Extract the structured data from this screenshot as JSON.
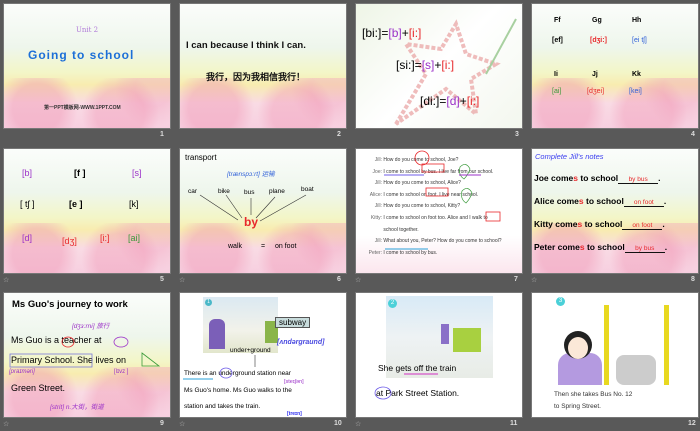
{
  "slides": [
    {
      "number": "1",
      "unit": "Unit 2",
      "title": "Going to school",
      "footer": "第一PPT模板网-WWW.1PPT.COM"
    },
    {
      "number": "2",
      "english": "I can because  I think I can.",
      "chinese": "我行，因为我相信我行！"
    },
    {
      "number": "3",
      "line1": [
        "[bi:]=",
        "[b]",
        "+",
        "[i:]"
      ],
      "line2": [
        "[si:]=",
        "[s]",
        "+",
        "[i:]"
      ],
      "line3": [
        "[di:]=",
        "[d]",
        "+",
        "[i:]"
      ]
    },
    {
      "number": "4",
      "letters": [
        "Ff",
        "Gg",
        "Hh",
        "Ii",
        "Jj",
        "Kk"
      ],
      "phonetics": [
        "[ef]",
        "[dʒi:]",
        "[ei tʃ]",
        "[ai]",
        "[dʒei]",
        "[kei]"
      ]
    },
    {
      "number": "5",
      "sounds": [
        "[b]",
        "[f ]",
        "[s]",
        "[ tʃ ]",
        "[e ]",
        "[k]",
        "[d]",
        "[dʒ]",
        "[i:]",
        "[ai]"
      ]
    },
    {
      "number": "6",
      "title": "transport",
      "phonetic": "[trænspɔ:rt] 运输",
      "vehicles": [
        "car",
        "bike",
        "bus",
        "plane",
        "boat"
      ],
      "by": "by",
      "walk": "walk",
      "equals": "=",
      "on_foot": "on foot"
    },
    {
      "number": "7",
      "lines": [
        {
          "speaker": "Jill:",
          "text": "How do you come to school, Joe?"
        },
        {
          "speaker": "Joe:",
          "text": "I come to school by bus. I live far from our school."
        },
        {
          "speaker": "Jill:",
          "text": "How do you come to school, Alice?"
        },
        {
          "speaker": "Alice:",
          "text": "I come to school on foot. I live near school."
        },
        {
          "speaker": "Jill:",
          "text": "How do you come to school, Kitty?"
        },
        {
          "speaker": "Kitty:",
          "text": "I come to school on foot too. Alice and I walk to"
        },
        {
          "speaker": "",
          "text": "school together."
        },
        {
          "speaker": "Jill:",
          "text": "What about you, Peter? How do you come to school?"
        },
        {
          "speaker": "Peter:",
          "text": "I come to school by bus."
        }
      ]
    },
    {
      "number": "8",
      "heading": "Complete Jill's notes",
      "rows": [
        {
          "name": "Joe",
          "verb": "come",
          "s": "s",
          "rest": "to school",
          "answer": "by bus"
        },
        {
          "name": "Alice",
          "verb": "come",
          "s": "s",
          "rest": "to school",
          "answer": "on foot"
        },
        {
          "name": "Kitty",
          "verb": "come",
          "s": "s",
          "rest": "to school",
          "answer": "on foot"
        },
        {
          "name": "Peter",
          "verb": "come",
          "s": "s",
          "rest": "to school",
          "answer": "by bus"
        }
      ]
    },
    {
      "number": "9",
      "title": "Ms Guo's journey  to work",
      "p1": "[dʒɜ:rni] 旅行",
      "l1": "Ms Guo is a teacher at",
      "l2": "Primary School. She lives on",
      "p2": "[praɪməri]",
      "p3": "[lɪvz ]",
      "l3": "Green Street.",
      "p4": "[strit] n.大街，街道"
    },
    {
      "number": "10",
      "badge": "1",
      "word": "subway",
      "phonetic": "[ʌndərgraund]",
      "compound": "under+ground",
      "l1": "There is an underground station near",
      "p1": "[steɪʃən]",
      "l2": "Ms Guo's home. Ms Guo walks to the",
      "l3": "station and takes the train.",
      "p2": "[treɪn]"
    },
    {
      "number": "11",
      "badge": "2",
      "l1": "She gets off the train",
      "l2": "at Park Street Station."
    },
    {
      "number": "12",
      "badge": "3",
      "l1": "Then she takes Bus No. 12",
      "l2": "to Spring Street."
    }
  ]
}
